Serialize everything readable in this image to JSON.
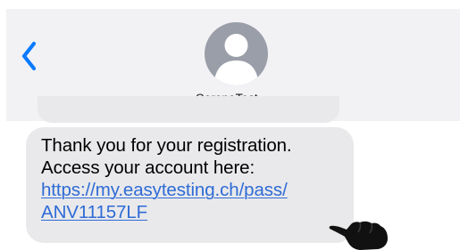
{
  "header": {
    "contact_name": "CoronaTest",
    "contact_chevron": "›",
    "back_icon": "chevron-left-icon",
    "avatar_icon": "person-silhouette-icon"
  },
  "message": {
    "line1": "Thank you for your registration.",
    "line2": "Access your account here:",
    "link_line1": "https://my.easytesting.ch/pass/",
    "link_line2": "ANV11157LF"
  },
  "overlay": {
    "pointer_icon": "pointing-hand-icon"
  },
  "colors": {
    "header_bg": "#f2f2f5",
    "accent_blue": "#0a7aff",
    "bubble_bg": "#e9e9eb",
    "link": "#2e6bd6",
    "avatar_bg": "#9a9ea8"
  }
}
